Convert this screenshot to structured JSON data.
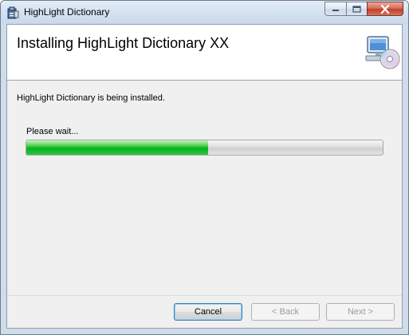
{
  "window": {
    "title": "HighLight Dictionary"
  },
  "icons": {
    "app": "installer-app-icon",
    "minimize": "minimize-icon",
    "maximize": "maximize-icon",
    "close": "close-icon",
    "banner": "computer-with-disc-icon"
  },
  "banner": {
    "heading": "Installing HighLight Dictionary XX"
  },
  "status": {
    "message": "HighLight Dictionary is being installed.",
    "wait_label": "Please wait...",
    "progress_fraction": 0.51
  },
  "buttons": {
    "cancel": "Cancel",
    "back": "< Back",
    "next": "Next >"
  },
  "colors": {
    "progress_green": "#06b025",
    "close_red": "#c23f26"
  }
}
